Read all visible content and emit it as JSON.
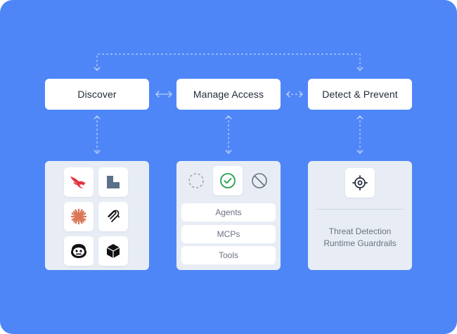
{
  "colors": {
    "background": "#4f86f7",
    "connector": "#b9d0ff",
    "card": "#ffffff",
    "panel": "#e8edf5",
    "text": "#1f2937",
    "muted_text": "#6b7280",
    "check_green": "#22a04b"
  },
  "stages": {
    "discover": "Discover",
    "manage_access": "Manage Access",
    "detect_prevent": "Detect & Prevent"
  },
  "discover_panel": {
    "icons": [
      "falcon-logo-icon",
      "folded-square-logo-icon",
      "starburst-logo-icon",
      "paperclip-logo-icon",
      "robot-face-logo-icon",
      "cube-logo-icon"
    ]
  },
  "manage_panel": {
    "status_icons": [
      "dashed-circle-icon",
      "check-circle-icon",
      "blocked-circle-icon"
    ],
    "items": [
      "Agents",
      "MCPs",
      "Tools"
    ]
  },
  "detect_panel": {
    "icon": "target-icon",
    "line1": "Threat Detection",
    "line2": "Runtime Guardrails"
  }
}
